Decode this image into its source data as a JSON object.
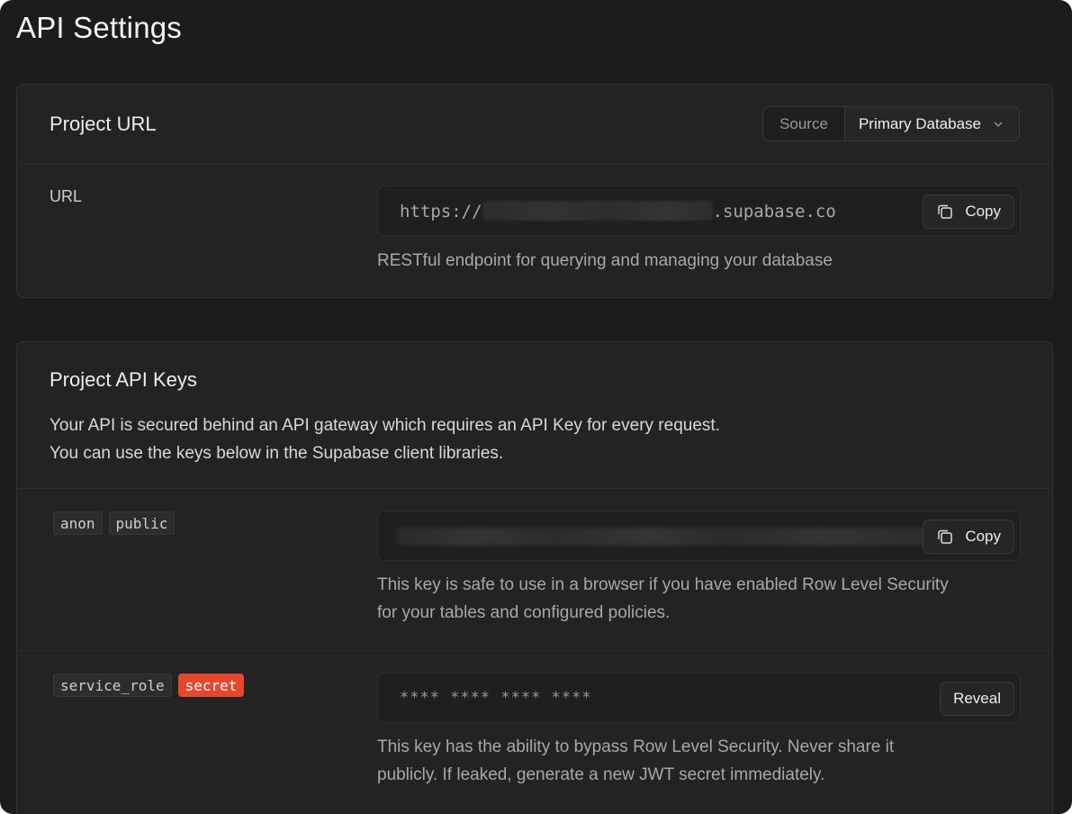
{
  "page": {
    "title": "API Settings"
  },
  "project_url": {
    "title": "Project URL",
    "source_label": "Source",
    "source_value": "Primary Database",
    "row_label": "URL",
    "url_prefix": "https://",
    "url_suffix": ".supabase.co",
    "copy_label": "Copy",
    "help": "RESTful endpoint for querying and managing your database"
  },
  "api_keys": {
    "title": "Project API Keys",
    "desc_line1": "Your API is secured behind an API gateway which requires an API Key for every request.",
    "desc_line2": "You can use the keys below in the Supabase client libraries.",
    "anon": {
      "tags": [
        "anon",
        "public"
      ],
      "copy_label": "Copy",
      "help_line1": "This key is safe to use in a browser if you have enabled Row Level Security",
      "help_line2": "for your tables and configured policies."
    },
    "service": {
      "tags": [
        "service_role",
        "secret"
      ],
      "masked_value": "**** **** **** ****",
      "reveal_label": "Reveal",
      "help_line1": "This key has the ability to bypass Row Level Security. Never share it",
      "help_line2": "publicly. If leaked, generate a new JWT secret immediately."
    }
  },
  "colors": {
    "background": "#1c1c1c",
    "card": "#232323",
    "secret_tag": "#e5482f"
  }
}
